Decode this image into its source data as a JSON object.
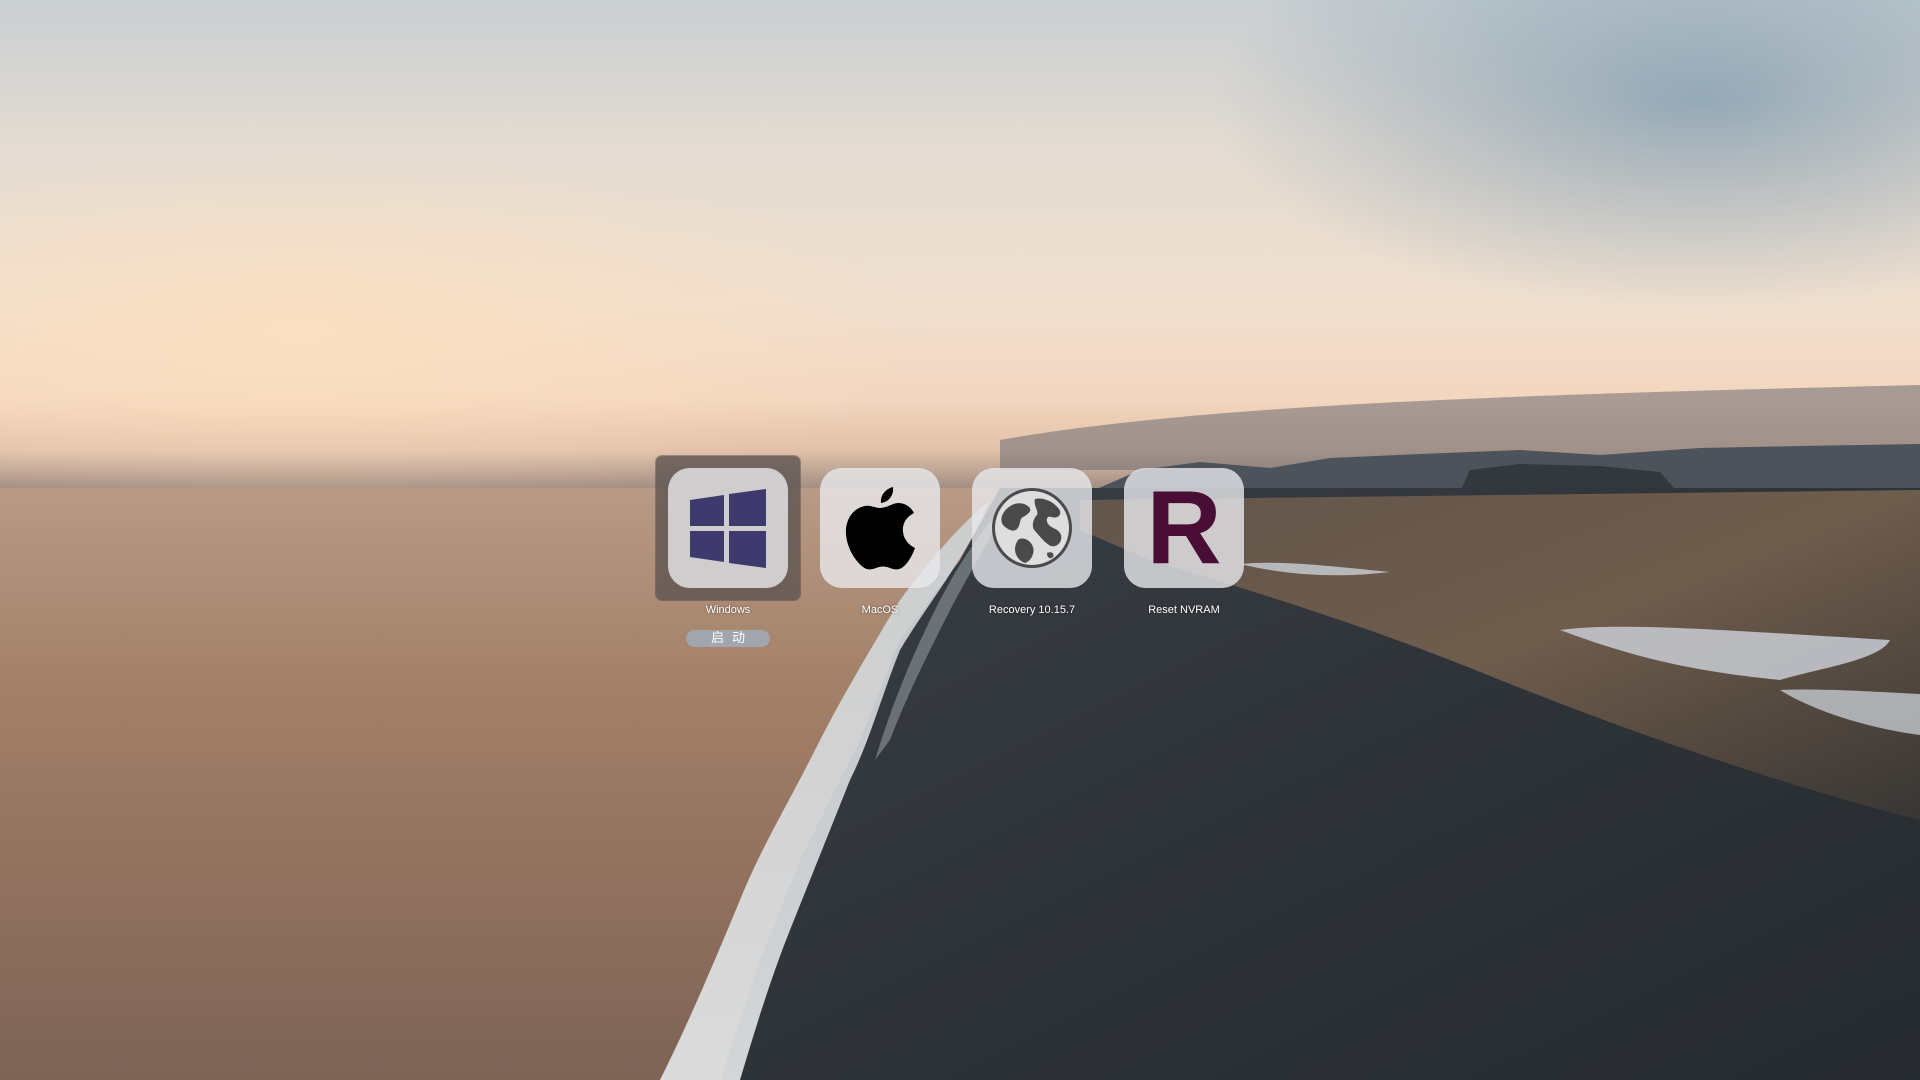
{
  "boot_entries": [
    {
      "label": "Windows",
      "icon": "windows-icon",
      "selected": true
    },
    {
      "label": "MacOS",
      "icon": "apple-icon",
      "selected": false
    },
    {
      "label": "Recovery 10.15.7",
      "icon": "globe-icon",
      "selected": false
    },
    {
      "label": "Reset NVRAM",
      "icon": "r-letter-icon",
      "glyph": "R",
      "selected": false
    }
  ],
  "start_button": {
    "label": "启动"
  },
  "colors": {
    "windows_logo": "#3f3a6e",
    "apple_logo": "#000000",
    "globe": "#4a4a4a",
    "reset_glyph": "#4a0e36",
    "tile_bg": "#e8e8ec",
    "selection_bg": "#5f5552",
    "start_button_bg": "#a0aab9"
  },
  "wallpaper": "aerial view of black sand beach and ocean at sunset"
}
